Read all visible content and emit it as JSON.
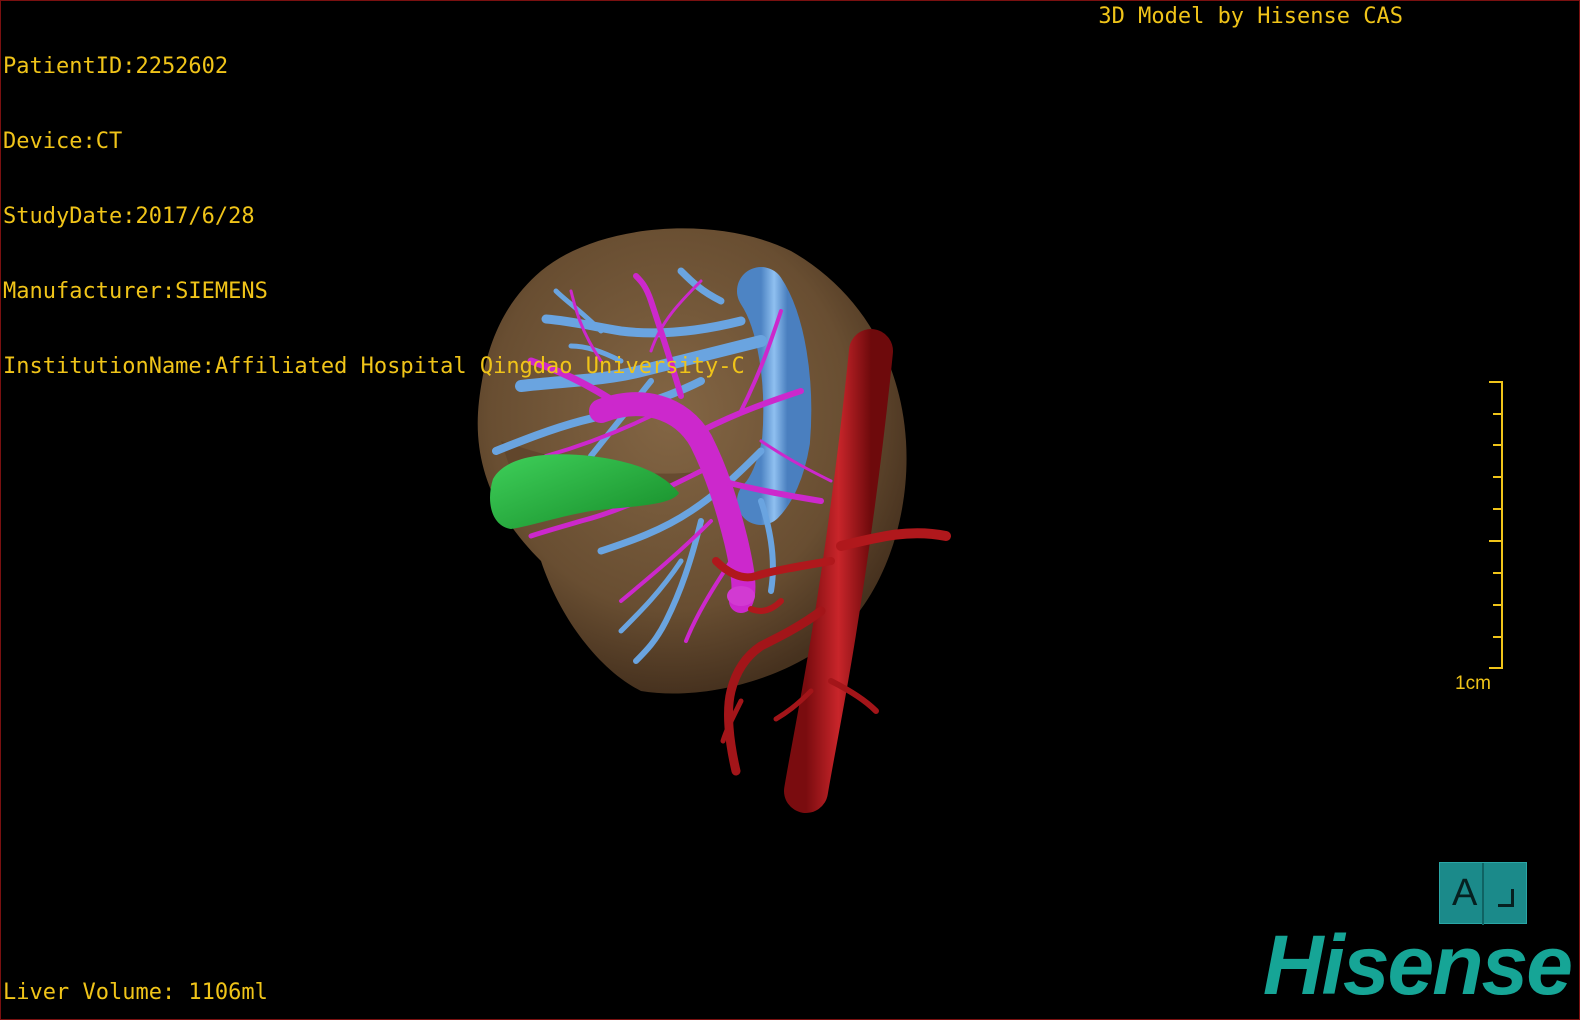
{
  "patient_info": {
    "patient_id": "PatientID:2252602",
    "device": "Device:CT",
    "study_date": "StudyDate:2017/6/28",
    "manufacturer": "Manufacturer:SIEMENS",
    "institution": "InstitutionName:Affiliated Hospital Qingdao University-C"
  },
  "credit": "3D Model by Hisense CAS",
  "liver_volume": "Liver Volume: 1106ml",
  "scale": {
    "label": "1cm"
  },
  "orientation_cube": {
    "letter": "A",
    "icon": "orientation-cube-icon"
  },
  "brand": "Hisense",
  "model": {
    "structures": [
      "liver-surface",
      "gallbladder",
      "hepatic-vein",
      "portal-vein",
      "aorta-artery"
    ],
    "colors": {
      "text": "#f0c419",
      "liver": "#8a6a45",
      "gallbladder": "#22b33a",
      "hepatic_vein": "#6aa4e0",
      "portal_vein": "#cc28cc",
      "artery": "#b0181c",
      "cube": "#1b8a8a",
      "brand": "#16a596"
    }
  }
}
